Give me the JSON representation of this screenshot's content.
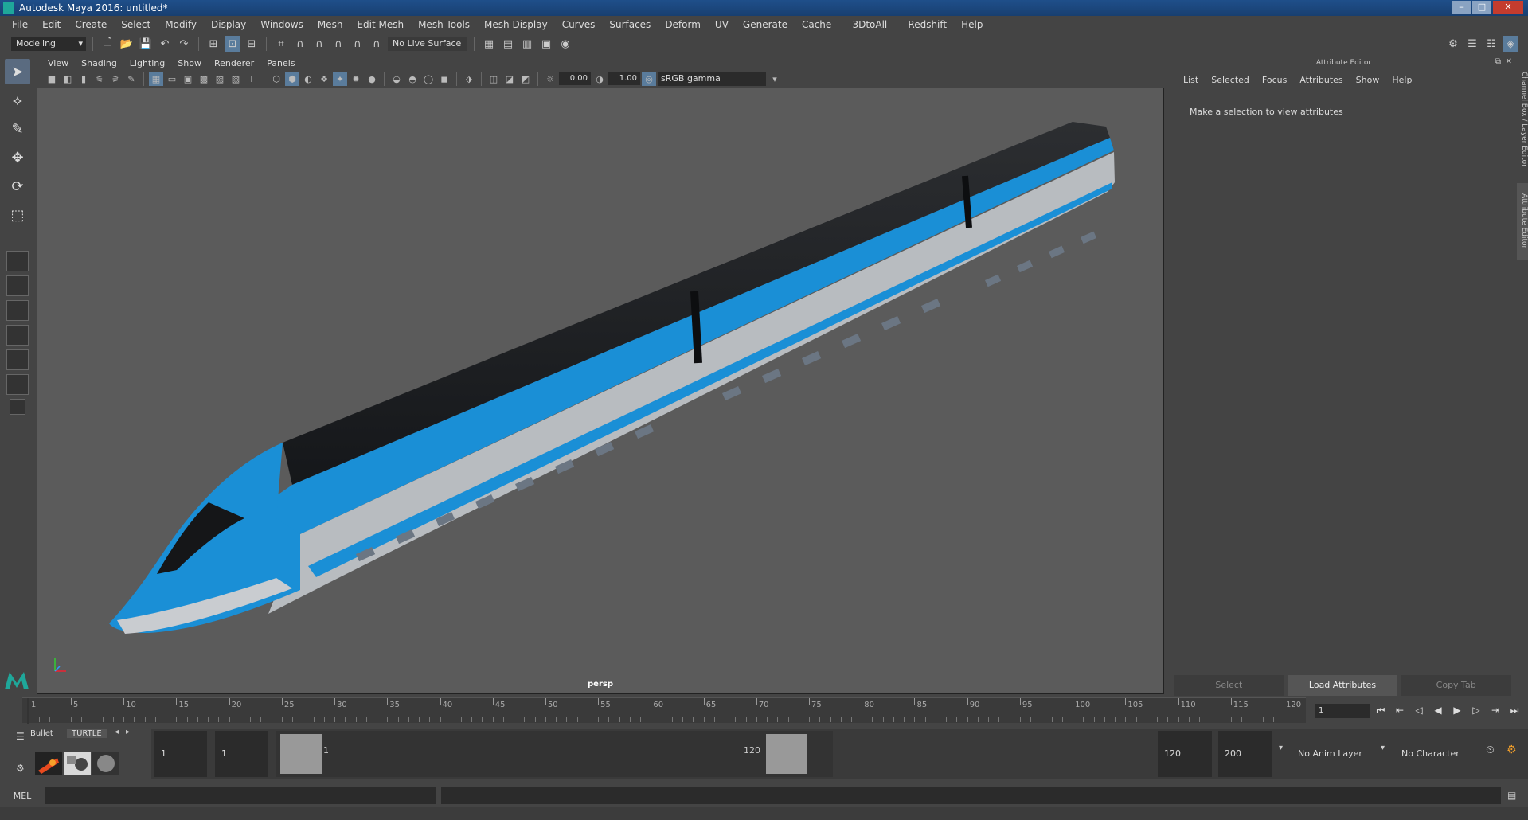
{
  "window": {
    "title": "Autodesk Maya 2016: untitled*",
    "min": "–",
    "max": "□",
    "close": "✕"
  },
  "menus": [
    "File",
    "Edit",
    "Create",
    "Select",
    "Modify",
    "Display",
    "Windows",
    "Mesh",
    "Edit Mesh",
    "Mesh Tools",
    "Mesh Display",
    "Curves",
    "Surfaces",
    "Deform",
    "UV",
    "Generate",
    "Cache",
    "- 3DtoAll -",
    "Redshift",
    "Help"
  ],
  "statusline": {
    "mode": "Modeling",
    "live_surface": "No Live Surface"
  },
  "panel_menu": [
    "View",
    "Shading",
    "Lighting",
    "Show",
    "Renderer",
    "Panels"
  ],
  "panel_toolbar": {
    "exposure": "0.00",
    "gamma": "1.00",
    "color_space": "sRGB gamma"
  },
  "viewport": {
    "camera": "persp"
  },
  "attribute_editor": {
    "title": "Attribute Editor",
    "menu": [
      "List",
      "Selected",
      "Focus",
      "Attributes",
      "Show",
      "Help"
    ],
    "message": "Make a selection to view attributes",
    "buttons": [
      "Select",
      "Load Attributes",
      "Copy Tab"
    ]
  },
  "side_tabs": [
    "Channel Box / Layer Editor",
    "Attribute Editor"
  ],
  "timeline": {
    "ticks": [
      "1",
      "5",
      "10",
      "15",
      "20",
      "25",
      "30",
      "35",
      "40",
      "45",
      "50",
      "55",
      "60",
      "65",
      "70",
      "75",
      "80",
      "85",
      "90",
      "95",
      "100",
      "105",
      "110",
      "115",
      "120"
    ],
    "current_frame": "1"
  },
  "shelf": {
    "tabs": [
      "Bullet",
      "TURTLE"
    ]
  },
  "range": {
    "start": "1",
    "anim_start": "1",
    "range_start_label": "1",
    "range_end_label": "120",
    "anim_end": "120",
    "end": "200",
    "anim_layer": "No Anim Layer",
    "character_set": "No Character Set"
  },
  "command": {
    "label": "MEL"
  },
  "colors": {
    "train_blue": "#1a8fd6",
    "train_grey": "#b8bcc0",
    "train_black": "#1d1f22",
    "viewport_bg": "#5b5b5b"
  }
}
